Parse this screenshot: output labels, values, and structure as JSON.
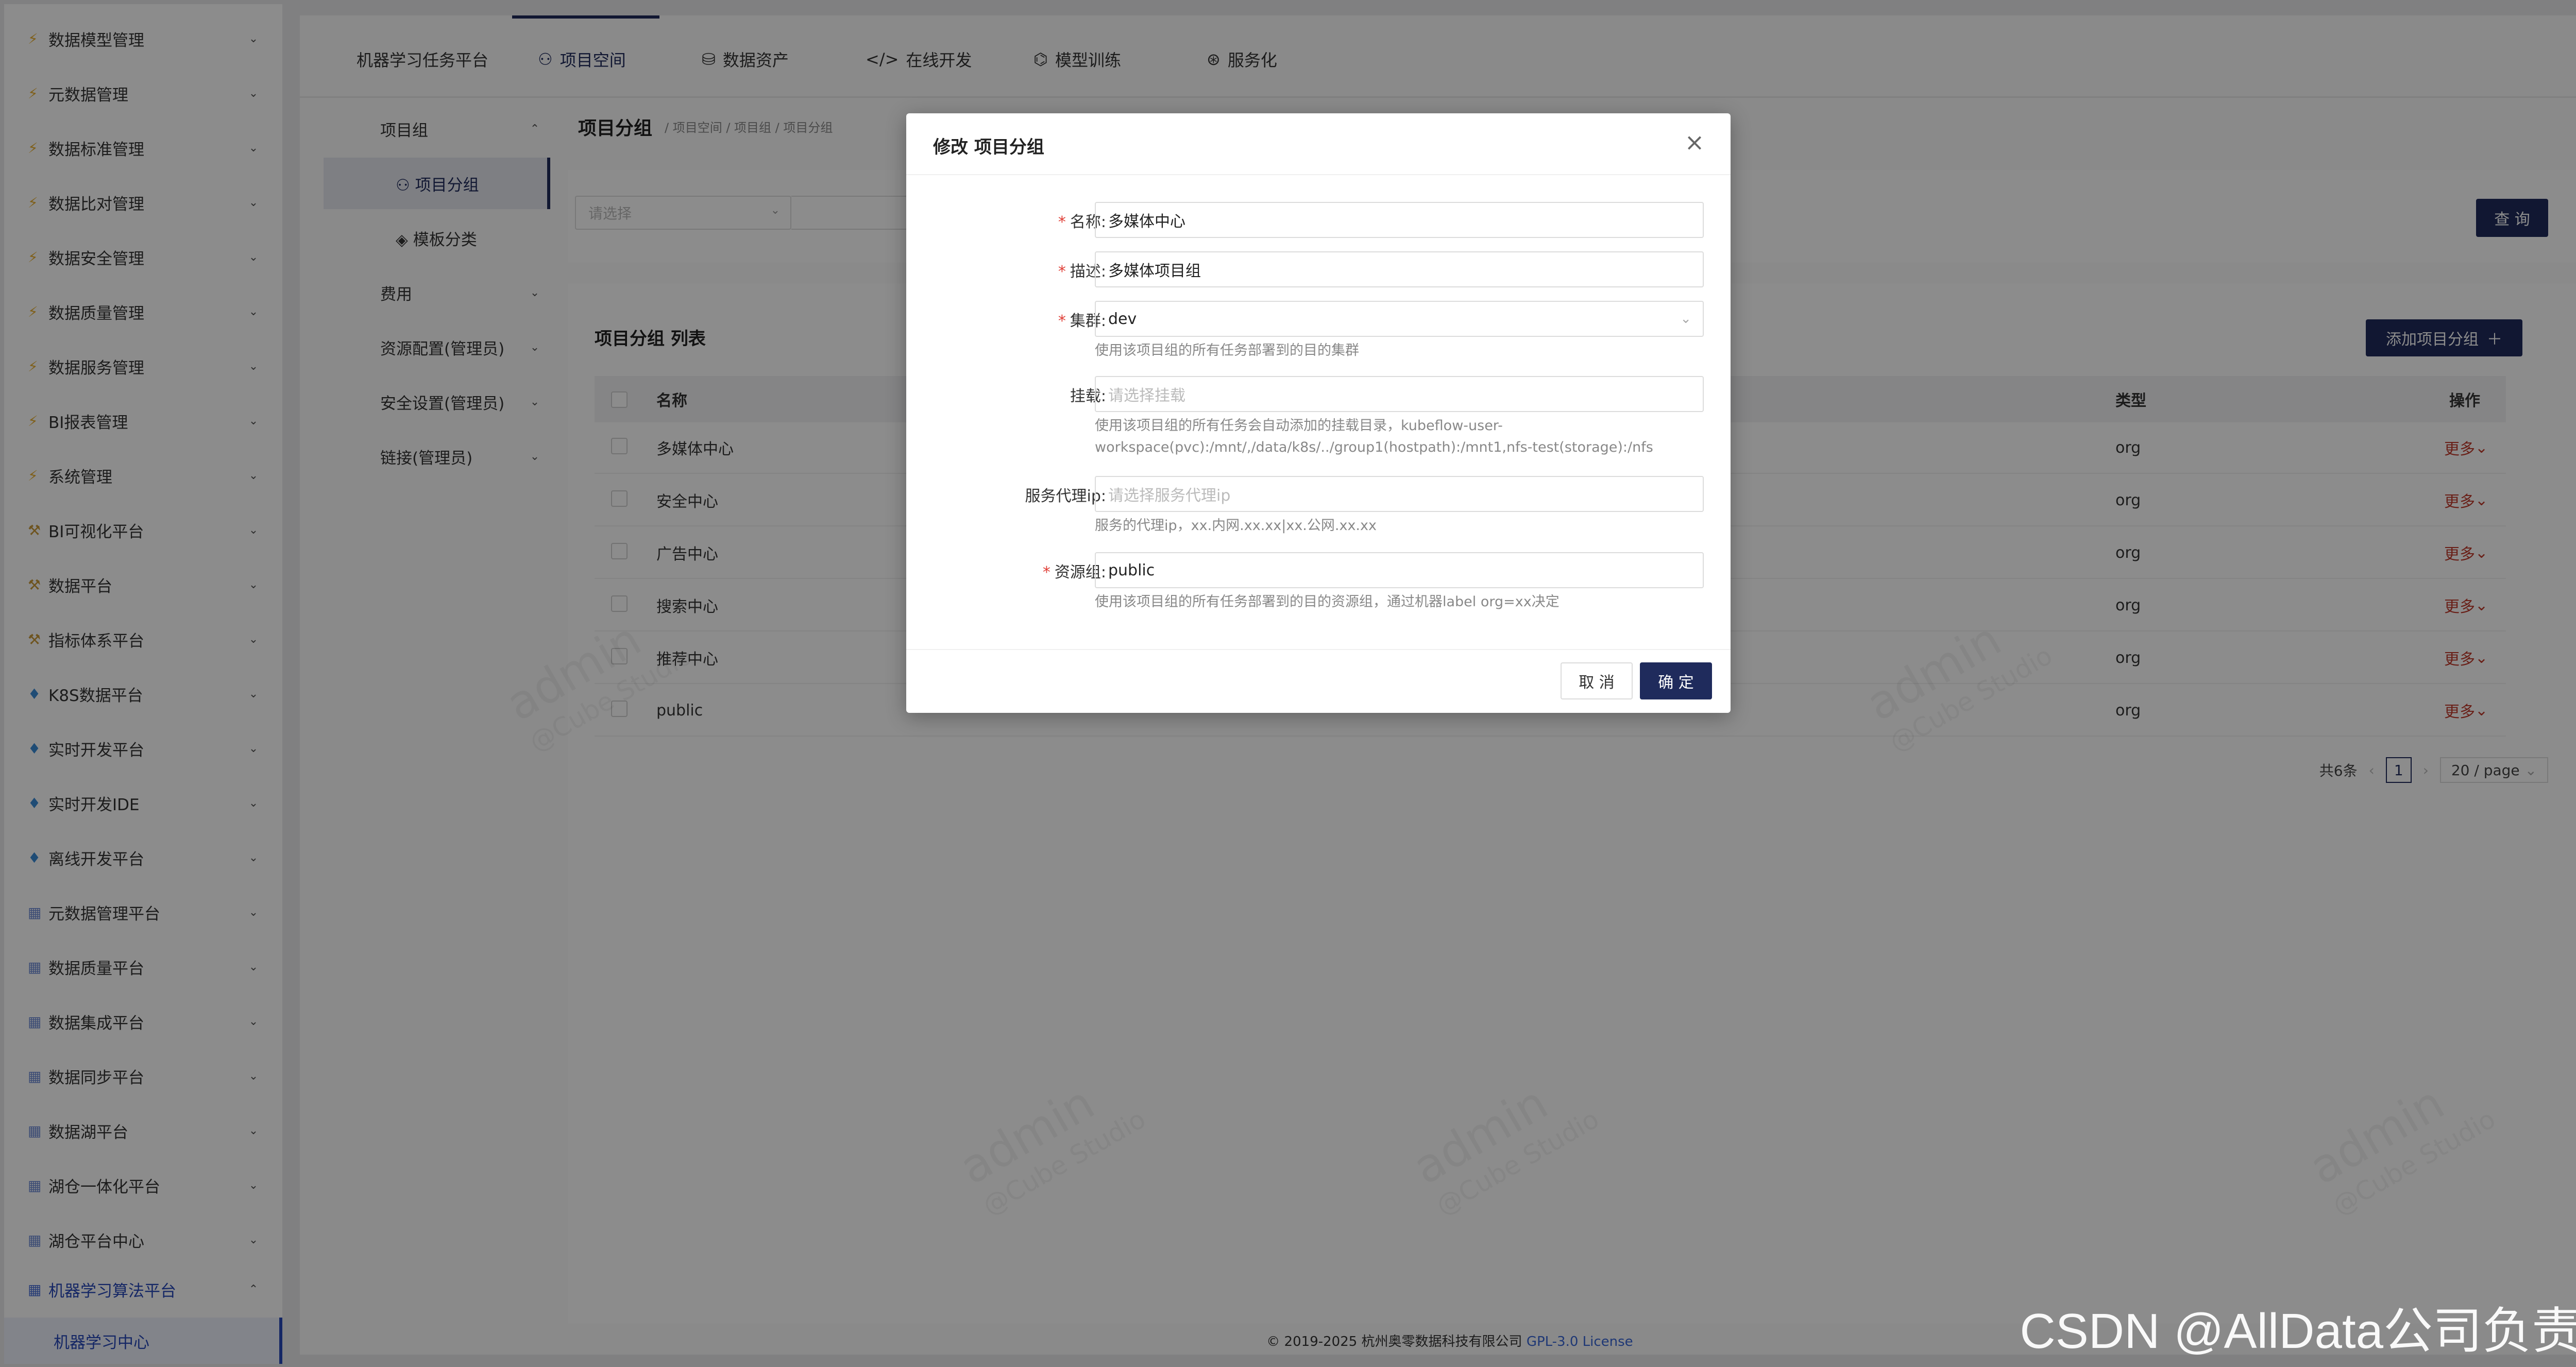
{
  "sidebar": {
    "items": [
      {
        "label": "数据模型管理",
        "icon": "bolt-icon"
      },
      {
        "label": "元数据管理",
        "icon": "bolt-icon"
      },
      {
        "label": "数据标准管理",
        "icon": "bolt-icon"
      },
      {
        "label": "数据比对管理",
        "icon": "bolt-icon"
      },
      {
        "label": "数据安全管理",
        "icon": "bolt-icon"
      },
      {
        "label": "数据质量管理",
        "icon": "bolt-icon"
      },
      {
        "label": "数据服务管理",
        "icon": "bolt-icon"
      },
      {
        "label": "BI报表管理",
        "icon": "bolt-icon"
      },
      {
        "label": "系统管理",
        "icon": "bolt-icon"
      },
      {
        "label": "BI可视化平台",
        "icon": "tool-icon"
      },
      {
        "label": "数据平台",
        "icon": "tool-icon"
      },
      {
        "label": "指标体系平台",
        "icon": "tool-icon"
      },
      {
        "label": "K8S数据平台",
        "icon": "diamond-icon"
      },
      {
        "label": "实时开发平台",
        "icon": "diamond-icon"
      },
      {
        "label": "实时开发IDE",
        "icon": "diamond-icon"
      },
      {
        "label": "离线开发平台",
        "icon": "diamond-icon"
      },
      {
        "label": "元数据管理平台",
        "icon": "grid-icon"
      },
      {
        "label": "数据质量平台",
        "icon": "grid-icon"
      },
      {
        "label": "数据集成平台",
        "icon": "grid-icon"
      },
      {
        "label": "数据同步平台",
        "icon": "grid-icon"
      },
      {
        "label": "数据湖平台",
        "icon": "grid-icon"
      },
      {
        "label": "湖仓一体化平台",
        "icon": "grid-icon"
      },
      {
        "label": "湖仓平台中心",
        "icon": "grid-icon"
      },
      {
        "label": "机器学习算法平台",
        "icon": "grid-icon"
      }
    ],
    "sub_item": "机器学习中心"
  },
  "topnav": {
    "tabs": [
      {
        "label": "机器学习任务平台",
        "icon": ""
      },
      {
        "label": "项目空间",
        "icon": "team-icon"
      },
      {
        "label": "数据资产",
        "icon": "database-icon"
      },
      {
        "label": "在线开发",
        "icon": "code-icon"
      },
      {
        "label": "模型训练",
        "icon": "train-icon"
      },
      {
        "label": "服务化",
        "icon": "service-icon"
      }
    ]
  },
  "subnav": {
    "items": [
      {
        "label": "项目组"
      },
      {
        "label": "项目分组"
      },
      {
        "label": "模板分类"
      },
      {
        "label": "费用"
      },
      {
        "label": "资源配置(管理员)"
      },
      {
        "label": "安全设置(管理员)"
      },
      {
        "label": "链接(管理员)"
      }
    ]
  },
  "page": {
    "title": "项目分组",
    "breadcrumb": "/ 项目空间 / 项目组 / 项目分组"
  },
  "filter": {
    "select_placeholder": "请选择",
    "query_label": "查 询"
  },
  "list": {
    "title": "项目分组 列表",
    "add_label": "添加项目分组",
    "columns": {
      "name": "名称",
      "type": "类型",
      "action": "操作"
    },
    "rows": [
      {
        "name": "多媒体中心",
        "type": "org",
        "action": "更多"
      },
      {
        "name": "安全中心",
        "type": "org",
        "action": "更多"
      },
      {
        "name": "广告中心",
        "type": "org",
        "action": "更多"
      },
      {
        "name": "搜索中心",
        "type": "org",
        "action": "更多"
      },
      {
        "name": "推荐中心",
        "type": "org",
        "action": "更多"
      },
      {
        "name": "public",
        "type": "org",
        "action": "更多"
      }
    ],
    "pager": {
      "total": "共6条",
      "current": "1",
      "size": "20 / page"
    }
  },
  "footer": {
    "copyright": "© 2019-2025 杭州奥零数据科技有限公司",
    "license": "GPL-3.0 License"
  },
  "watermark": {
    "user": "admin",
    "product": "@Cube Studio"
  },
  "modal": {
    "title": "修改 项目分组",
    "fields": {
      "name": {
        "label": "名称:",
        "value": "多媒体中心"
      },
      "describe": {
        "label": "描述:",
        "value": "多媒体项目组"
      },
      "cluster": {
        "label": "集群:",
        "value": "dev",
        "help": "使用该项目组的所有任务部署到的目的集群"
      },
      "mount": {
        "label": "挂载:",
        "placeholder": "请选择挂载",
        "help": "使用该项目组的所有任务会自动添加的挂载目录，kubeflow-user-workspace(pvc):/mnt/,/data/k8s/../group1(hostpath):/mnt1,nfs-test(storage):/nfs"
      },
      "proxy": {
        "label": "服务代理ip:",
        "placeholder": "请选择服务代理ip",
        "help": "服务的代理ip，xx.内网.xx.xx|xx.公网.xx.xx"
      },
      "resource": {
        "label": "资源组:",
        "value": "public",
        "help": "使用该项目组的所有任务部署到的目的资源组，通过机器label org=xx决定"
      }
    },
    "cancel_label": "取 消",
    "ok_label": "确 定"
  },
  "brand_watermark": "CSDN @AllData公司负责人",
  "colors": {
    "primary": "#1f2b5c",
    "required": "#e03e36",
    "more_link": "#c0392b",
    "sidebar_active": "#2747b8"
  }
}
